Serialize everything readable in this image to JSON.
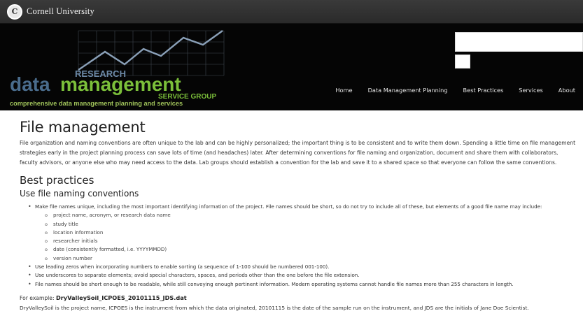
{
  "top_bar": {
    "university_name": "Cornell University"
  },
  "banner": {
    "logo_research": "RESEARCH",
    "logo_data": "data",
    "logo_management": "management",
    "logo_service_group": "SERVICE GROUP",
    "logo_tagline": "comprehensive data management planning and services"
  },
  "nav": {
    "items": [
      {
        "label": "Home"
      },
      {
        "label": "Data Management Planning"
      },
      {
        "label": "Best Practices"
      },
      {
        "label": "Services"
      },
      {
        "label": "About"
      }
    ]
  },
  "main": {
    "title": "File management",
    "intro": "File organization and naming conventions are often unique to the lab and can be highly personalized; the important thing is to be consistent and to write them down. Spending a little time on file management strategies early in the project planning process can save lots of time (and headaches) later. After determining conventions for file naming and organization, document and share them with collaborators, faculty advisors, or anyone else who may need access to the data. Lab groups should establish a convention for the lab and save it to a shared space so that everyone can follow the same conventions.",
    "section_title": "Best practices",
    "subsection_title": "Use file naming conventions",
    "bullets": [
      "Make file names unique, including the most important identifying information of the project. File names should be short, so do not try to include all of these, but elements of a good file name may include:",
      "Use leading zeros when incorporating numbers to enable sorting (a sequence of 1-100 should be numbered 001-100).",
      "Use underscores to separate elements; avoid special characters, spaces, and periods other than the one before the file extension.",
      "File names should be short enough to be readable, while still conveying enough pertinent information. Modern operating systems cannot handle file names more than 255 characters in length."
    ],
    "sub_items": [
      "project name, acronym, or research data name",
      "study title",
      "location information",
      "researcher initials",
      "date (consistently formatted, i.e. YYYYMMDD)",
      "version number"
    ],
    "example_prefix": "For example: ",
    "example_filename": "DryValleySoil_ICPOES_20101115_JDS.dat",
    "example_explanation": "DryValleySoil is the project name, ICPOES is the instrument from which the data originated, 20101115 is the date of the sample run on the instrument, and JDS are the initials of Jane Doe Scientist."
  },
  "colors": {
    "top_bar": "#2f2f2f",
    "banner_bg": "#050505",
    "logo_blue": "#4a6c8c",
    "logo_green": "#7bbf3a",
    "logo_tagline": "#9fc25a"
  }
}
